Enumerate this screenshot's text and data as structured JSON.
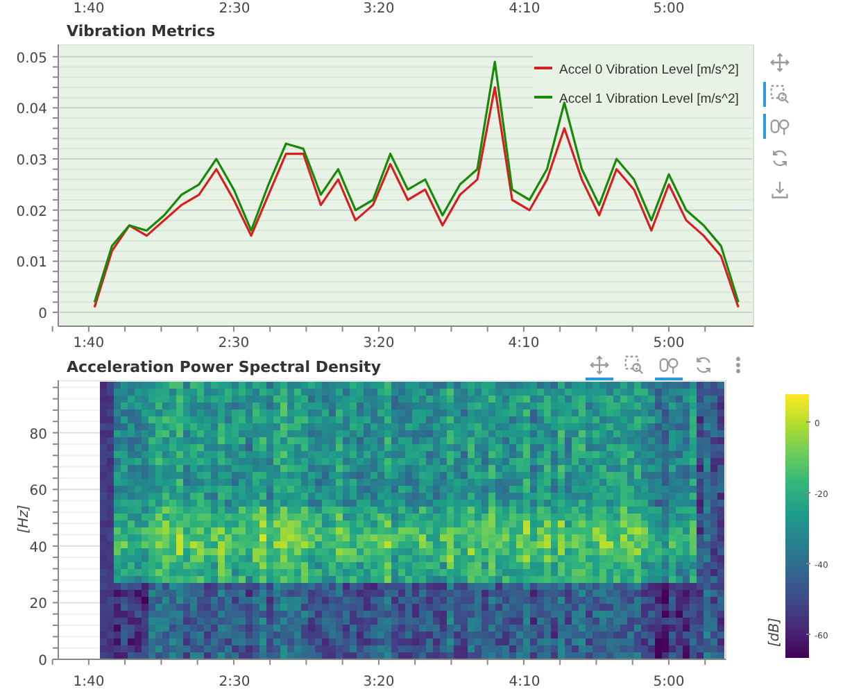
{
  "previous_chart_axis": {
    "xticks": [
      "1:40",
      "2:30",
      "3:20",
      "4:10",
      "5:00"
    ]
  },
  "vibration_chart": {
    "title": "Vibration Metrics",
    "chart_data": {
      "type": "line",
      "x": [
        102,
        108,
        114,
        120,
        126,
        132,
        138,
        144,
        150,
        156,
        162,
        168,
        174,
        180,
        186,
        192,
        198,
        204,
        210,
        216,
        222,
        228,
        234,
        240,
        246,
        252,
        258,
        264,
        270,
        276,
        282,
        288,
        294,
        300,
        306,
        312,
        318,
        324
      ],
      "xlim": [
        89.5,
        329.2
      ],
      "ylim": [
        -0.0027,
        0.0524
      ],
      "grid": true,
      "legend": true,
      "xticks": [
        {
          "value": 100,
          "label": "1:40"
        },
        {
          "value": 150,
          "label": "2:30"
        },
        {
          "value": 200,
          "label": "3:20"
        },
        {
          "value": 250,
          "label": "4:10"
        },
        {
          "value": 300,
          "label": "5:00"
        }
      ],
      "yticks": [
        0,
        0.01,
        0.02,
        0.03,
        0.04,
        0.05
      ],
      "series": [
        {
          "name": "Accel 0 Vibration Level [m/s^2]",
          "color": "#d62020",
          "values": [
            0.001,
            0.012,
            0.017,
            0.015,
            0.018,
            0.021,
            0.023,
            0.028,
            0.022,
            0.015,
            0.023,
            0.031,
            0.031,
            0.021,
            0.026,
            0.018,
            0.021,
            0.029,
            0.022,
            0.024,
            0.017,
            0.023,
            0.026,
            0.044,
            0.022,
            0.02,
            0.026,
            0.036,
            0.026,
            0.019,
            0.028,
            0.024,
            0.016,
            0.025,
            0.018,
            0.015,
            0.011,
            0.001
          ]
        },
        {
          "name": "Accel 1 Vibration Level [m/s^2]",
          "color": "#188a08",
          "values": [
            0.002,
            0.013,
            0.017,
            0.016,
            0.019,
            0.023,
            0.025,
            0.03,
            0.024,
            0.016,
            0.025,
            0.033,
            0.032,
            0.023,
            0.028,
            0.02,
            0.022,
            0.031,
            0.024,
            0.026,
            0.019,
            0.025,
            0.028,
            0.049,
            0.024,
            0.022,
            0.028,
            0.041,
            0.028,
            0.021,
            0.03,
            0.026,
            0.018,
            0.027,
            0.02,
            0.017,
            0.013,
            0.002
          ]
        }
      ]
    },
    "toolbar": [
      {
        "kind": "pan",
        "active": false
      },
      {
        "kind": "box_zoom",
        "active": true
      },
      {
        "kind": "wheel_zoom",
        "active": true
      },
      {
        "kind": "reset",
        "active": false
      },
      {
        "kind": "save",
        "active": false
      }
    ]
  },
  "psd_chart": {
    "title": "Acceleration Power Spectral Density",
    "ylabel": "[Hz]",
    "yticks": [
      "80",
      "60",
      "40",
      "20",
      "0"
    ],
    "xticks": [
      "1:40",
      "2:30",
      "3:20",
      "4:10",
      "5:00"
    ],
    "toolbar": [
      {
        "kind": "pan",
        "active": true
      },
      {
        "kind": "box_zoom",
        "active": false
      },
      {
        "kind": "wheel_zoom",
        "active": true
      },
      {
        "kind": "reset",
        "active": false
      },
      {
        "kind": "more",
        "active": false
      }
    ],
    "colorbar": {
      "label": "[dB]",
      "ticks": [
        "0",
        "-20",
        "-40",
        "-60"
      ]
    }
  }
}
